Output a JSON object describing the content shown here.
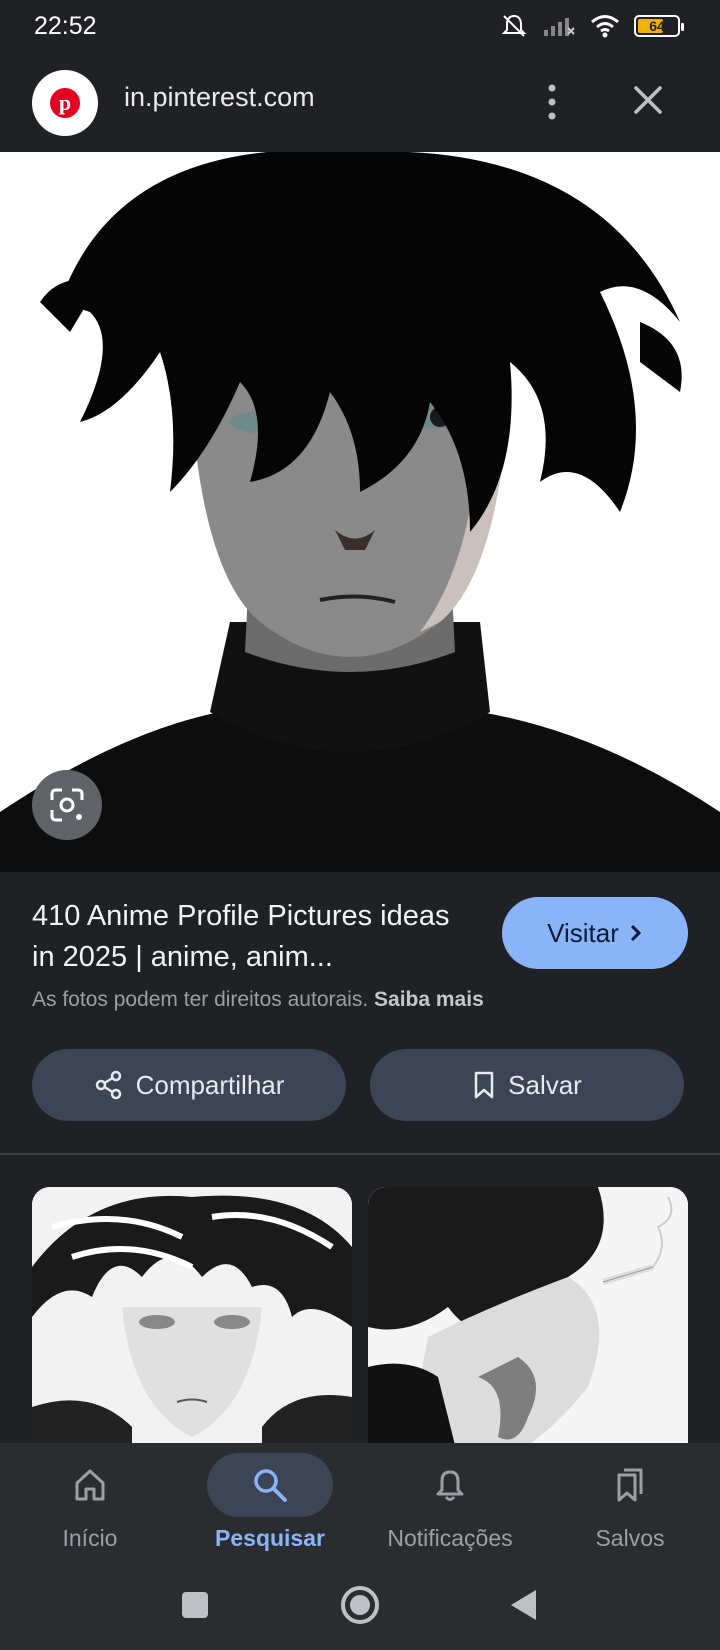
{
  "status_bar": {
    "time": "22:52",
    "battery_level": "64"
  },
  "browser": {
    "url": "in.pinterest.com",
    "logo_letter": "p"
  },
  "pin": {
    "title": "410 Anime Profile Pictures ideas in 2025 | anime, anim...",
    "visit_label": "Visitar",
    "copyright_text": "As fotos podem ter direitos autorais.",
    "learn_more": "Saiba mais"
  },
  "actions": {
    "share_label": "Compartilhar",
    "save_label": "Salvar"
  },
  "bottom_nav": {
    "items": [
      {
        "label": "Início",
        "icon": "home-icon"
      },
      {
        "label": "Pesquisar",
        "icon": "search-icon",
        "active": true
      },
      {
        "label": "Notificações",
        "icon": "bell-icon"
      },
      {
        "label": "Salvos",
        "icon": "bookmarks-icon"
      }
    ]
  },
  "colors": {
    "accent": "#8ab4f8",
    "pinterest_red": "#e60023",
    "background": "#1f2125",
    "chip": "#3c4556"
  }
}
